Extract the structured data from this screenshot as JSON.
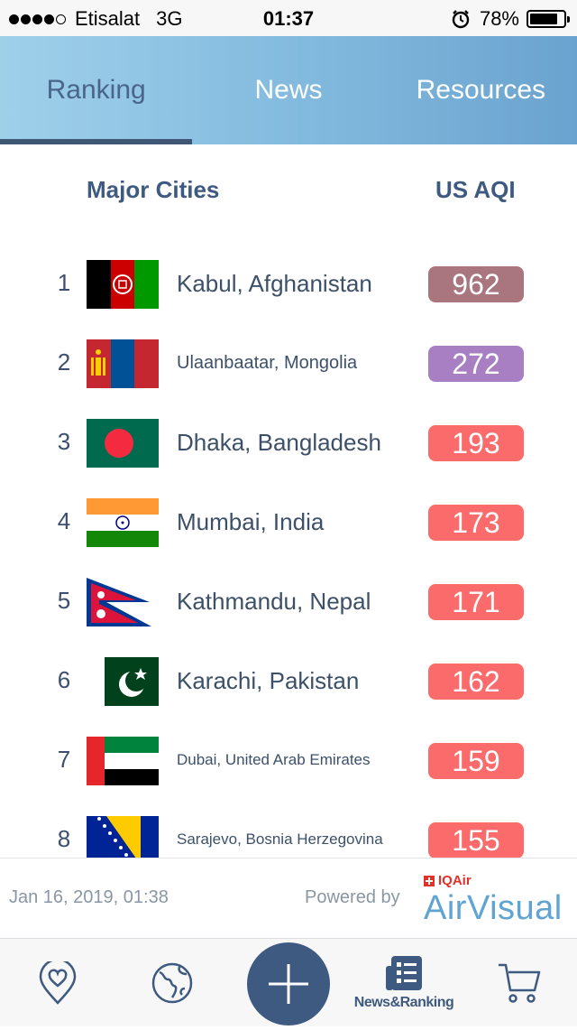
{
  "status_bar": {
    "carrier": "Etisalat",
    "network": "3G",
    "time": "01:37",
    "battery": "78%",
    "battery_level": 0.78,
    "signal_bars": 4
  },
  "tabs": [
    {
      "label": "Ranking",
      "active": true
    },
    {
      "label": "News",
      "active": false
    },
    {
      "label": "Resources",
      "active": false
    }
  ],
  "list_header": {
    "city_label": "Major Cities",
    "aqi_label": "US AQI"
  },
  "cities": [
    {
      "rank": "1",
      "name": "Kabul, Afghanistan",
      "aqi": "962",
      "color": "#a97680",
      "flag": "afghanistan-flag-icon"
    },
    {
      "rank": "2",
      "name": "Ulaanbaatar, Mongolia",
      "aqi": "272",
      "color": "#a97fc4",
      "flag": "mongolia-flag-icon"
    },
    {
      "rank": "3",
      "name": "Dhaka, Bangladesh",
      "aqi": "193",
      "color": "#fb6b6b",
      "flag": "bangladesh-flag-icon"
    },
    {
      "rank": "4",
      "name": "Mumbai, India",
      "aqi": "173",
      "color": "#fb6b6b",
      "flag": "india-flag-icon"
    },
    {
      "rank": "5",
      "name": "Kathmandu, Nepal",
      "aqi": "171",
      "color": "#fb6b6b",
      "flag": "nepal-flag-icon"
    },
    {
      "rank": "6",
      "name": "Karachi, Pakistan",
      "aqi": "162",
      "color": "#fb6b6b",
      "flag": "pakistan-flag-icon"
    },
    {
      "rank": "7",
      "name": "Dubai, United Arab Emirates",
      "aqi": "159",
      "color": "#fb6b6b",
      "flag": "uae-flag-icon"
    },
    {
      "rank": "8",
      "name": "Sarajevo, Bosnia Herzegovina",
      "aqi": "155",
      "color": "#fb6b6b",
      "flag": "bosnia-flag-icon"
    }
  ],
  "footer": {
    "date": "Jan 16, 2019, 01:38",
    "powered_by": "Powered by",
    "iqair": "IQAir",
    "airvisual": "AirVisual"
  },
  "bottom_nav": {
    "items": [
      {
        "icon": "heart-location-icon",
        "label": ""
      },
      {
        "icon": "globe-icon",
        "label": ""
      },
      {
        "icon": "plus-icon",
        "label": ""
      },
      {
        "icon": "news-list-icon",
        "label": "News&Ranking"
      },
      {
        "icon": "cart-icon",
        "label": ""
      }
    ]
  },
  "colors": {
    "accent": "#3f5a80",
    "tab_gradient_start": "#9fd0ea",
    "tab_gradient_end": "#6aa3cf"
  }
}
